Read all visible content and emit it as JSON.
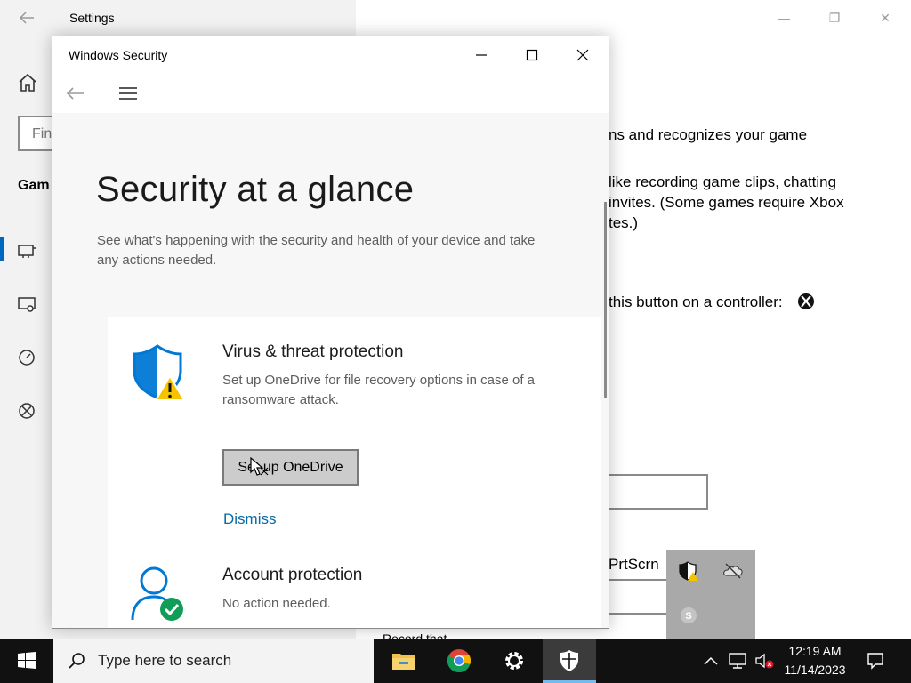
{
  "settings": {
    "title": "Settings",
    "search_partial": "Fin",
    "section_partial": "Gam",
    "line1": "ns and recognizes your game",
    "line2": " like recording game clips, chatting",
    "line3": " invites. (Some games require Xbox",
    "line4": "tes.)",
    "line5": "this button on a controller:",
    "prtscrn": "PrtScrn",
    "partial_bottom": "Record that"
  },
  "security": {
    "window_title": "Windows Security",
    "heading": "Security at a glance",
    "subtitle": "See what's happening with the security and health of your device and take any actions needed.",
    "virus": {
      "title": "Virus & threat protection",
      "description": "Set up OneDrive for file recovery options in case of a ransomware attack.",
      "button": "Set up OneDrive",
      "link": "Dismiss"
    },
    "account": {
      "title": "Account protection",
      "description": "No action needed."
    }
  },
  "taskbar": {
    "search_placeholder": "Type here to search",
    "time": "12:19 AM",
    "date": "11/14/2023",
    "apps": [
      "file-explorer-icon",
      "chrome-icon",
      "settings-gear-icon",
      "windows-security-shield-icon"
    ]
  },
  "colors": {
    "accent_blue": "#0078d4",
    "warning_yellow": "#f4c400",
    "success_green": "#0f9d58",
    "link_blue": "#0b6aa2"
  }
}
